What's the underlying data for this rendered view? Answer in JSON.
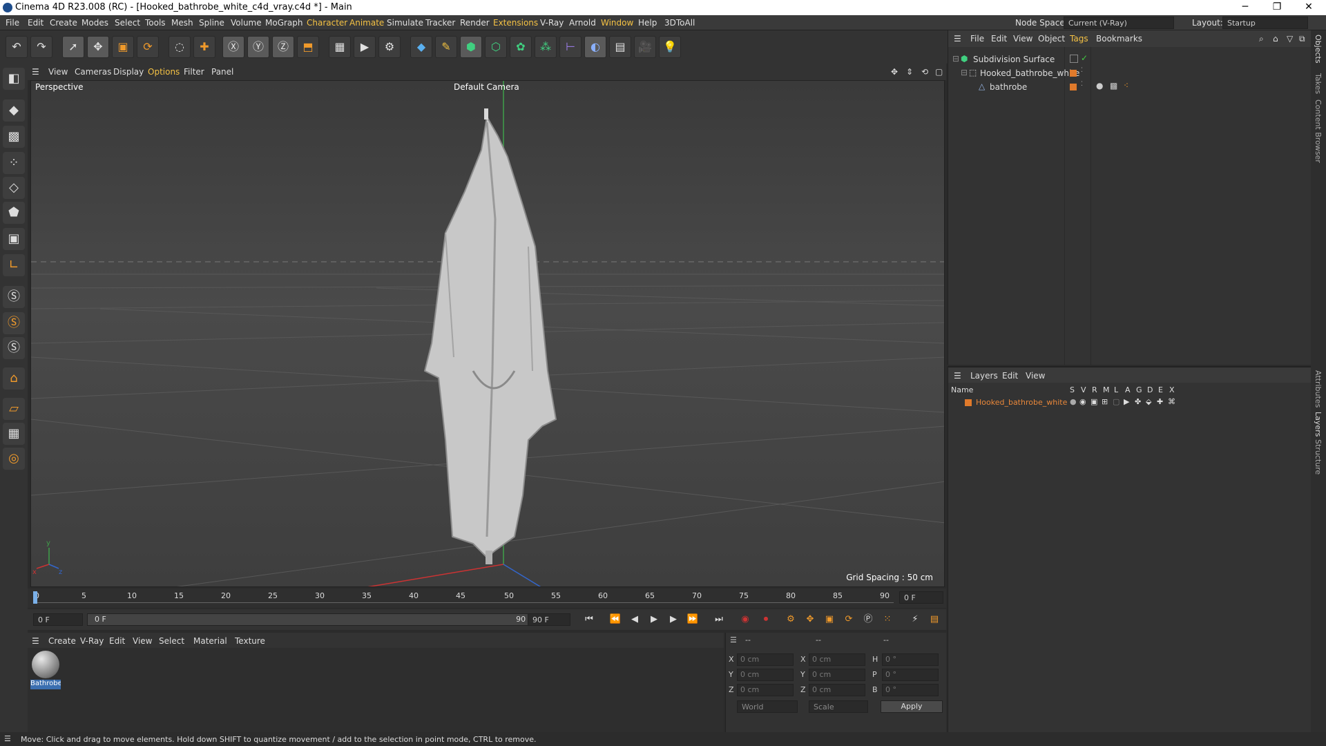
{
  "window": {
    "title": "Cinema 4D R23.008 (RC) - [Hooked_bathrobe_white_c4d_vray.c4d *] - Main",
    "minimize": "─",
    "restore": "❐",
    "close": "✕"
  },
  "menubar": {
    "items": [
      "File",
      "Edit",
      "Create",
      "Modes",
      "Select",
      "Tools",
      "Mesh",
      "Spline",
      "Volume",
      "MoGraph",
      "Character",
      "Animate",
      "Simulate",
      "Tracker",
      "Render",
      "Extensions",
      "V-Ray",
      "Arnold",
      "Window",
      "Help",
      "3DToAll"
    ],
    "node_space_label": "Node Space:",
    "node_space_value": "Current (V-Ray)",
    "layout_label": "Layout:",
    "layout_value": "Startup"
  },
  "viewport_menu": {
    "items": [
      "View",
      "Cameras",
      "Display",
      "Options",
      "Filter",
      "Panel"
    ]
  },
  "viewport": {
    "label": "Perspective",
    "camera": "Default Camera",
    "grid_spacing": "Grid Spacing : 50 cm"
  },
  "timeline": {
    "ticks": [
      "0",
      "5",
      "10",
      "15",
      "20",
      "25",
      "30",
      "35",
      "40",
      "45",
      "50",
      "55",
      "60",
      "65",
      "70",
      "75",
      "80",
      "85",
      "90"
    ],
    "frame_field": "0 F"
  },
  "playbar": {
    "start": "0 F",
    "range_start": "0 F",
    "range_end": "90 F",
    "end": "90 F"
  },
  "material_menu": {
    "items": [
      "Create",
      "V-Ray",
      "Edit",
      "View",
      "Select",
      "Material",
      "Texture"
    ]
  },
  "material": {
    "name": "Bathrobe"
  },
  "coords": {
    "header1": "--",
    "header2": "--",
    "header3": "--",
    "rows": [
      {
        "a": "X",
        "av": "0 cm",
        "b": "X",
        "bv": "0 cm",
        "c": "H",
        "cv": "0 °"
      },
      {
        "a": "Y",
        "av": "0 cm",
        "b": "Y",
        "bv": "0 cm",
        "c": "P",
        "cv": "0 °"
      },
      {
        "a": "Z",
        "av": "0 cm",
        "b": "Z",
        "bv": "0 cm",
        "c": "B",
        "cv": "0 °"
      }
    ],
    "space": "World",
    "mode": "Scale",
    "apply": "Apply"
  },
  "status": {
    "text": "Move: Click and drag to move elements. Hold down SHIFT to quantize movement / add to the selection in point mode, CTRL to remove."
  },
  "objects_menu": {
    "items": [
      "File",
      "Edit",
      "View",
      "Object",
      "Tags",
      "Bookmarks"
    ]
  },
  "objects": [
    {
      "name": "Subdivision Surface"
    },
    {
      "name": "Hooked_bathrobe_white"
    },
    {
      "name": "bathrobe"
    }
  ],
  "layers_menu": {
    "items": [
      "Layers",
      "Edit",
      "View"
    ]
  },
  "layers": {
    "header_name": "Name",
    "header_flags": [
      "S",
      "V",
      "R",
      "M",
      "L",
      "A",
      "G",
      "D",
      "E",
      "X"
    ],
    "rows": [
      {
        "name": "Hooked_bathrobe_white"
      }
    ]
  },
  "right_tabs": [
    "Objects",
    "Takes",
    "Content Browser",
    "Attributes",
    "Layers",
    "Structure"
  ],
  "colors": {
    "accent": "#e07a2b",
    "highlight": "#f5c244",
    "layer_text": "#e8873a"
  }
}
